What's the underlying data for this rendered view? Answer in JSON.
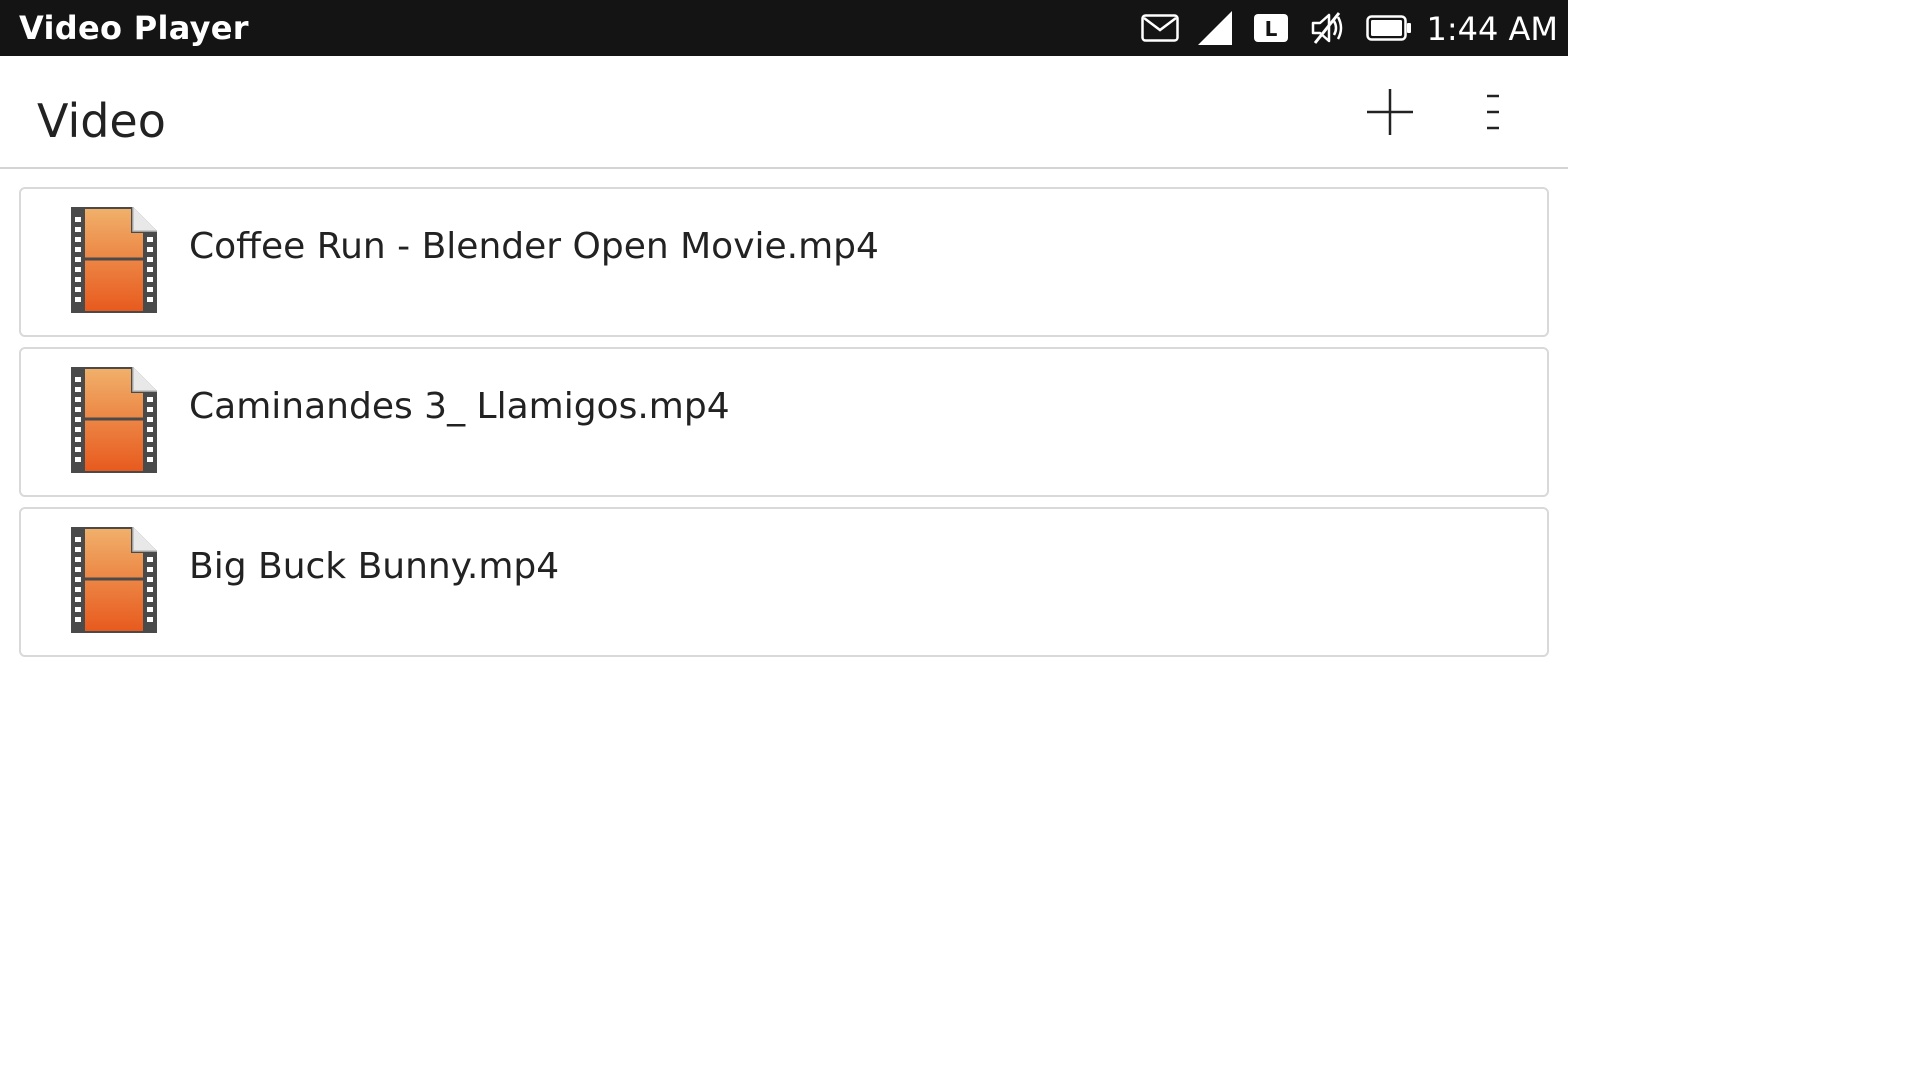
{
  "status_bar": {
    "app_name": "Video Player",
    "time": "1:44 AM",
    "icons": [
      "mail-icon",
      "signal-icon",
      "l-badge-icon",
      "volume-muted-icon",
      "battery-icon"
    ],
    "l_badge_text": "L"
  },
  "header": {
    "title": "Video",
    "actions": [
      "add-icon",
      "overflow-menu-icon"
    ]
  },
  "videos": [
    {
      "name": "Coffee Run - Blender Open Movie.mp4",
      "icon": "video-file-icon"
    },
    {
      "name": "Caminandes 3_ Llamigos.mp4",
      "icon": "video-file-icon"
    },
    {
      "name": "Big Buck Bunny.mp4",
      "icon": "video-file-icon"
    }
  ],
  "colors": {
    "status_bar_bg": "#141414",
    "film_orange_top": "#f0b06a",
    "film_orange_bottom": "#e85a1e",
    "film_strip": "#4a4a4a"
  }
}
